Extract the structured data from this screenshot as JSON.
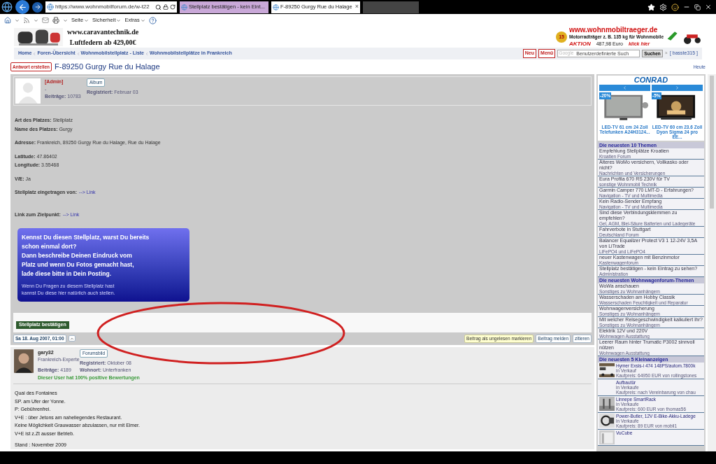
{
  "browser": {
    "address": "https://www.wohnmobilforum.de/w-t22",
    "tabs": [
      {
        "title": "Stellplatz bestätigen - kein Eint...",
        "selected": false
      },
      {
        "title": "F-89250 Gurgy Rue du Halage",
        "selected": true
      }
    ],
    "close": "×",
    "menus": [
      "Seite",
      "Sicherheit",
      "Extras"
    ]
  },
  "banner_left": {
    "line1": "www.caravantechnik.de",
    "line2": "Luftfedern ab 429,00€"
  },
  "banner_right": {
    "url": "www.wohnmobiltraeger.de",
    "text": "Motorradträger z. B. 135 kg für Wohnmobile",
    "badge": "AKTION",
    "price": "487,98 Euro",
    "link": "klick hier",
    "seal": "15"
  },
  "breadcrumb": [
    "Home",
    "Foren-Übersicht",
    "Wohnmobilstellplatz - Liste",
    "Wohnmobilstellplätze in Frankreich"
  ],
  "header_buttons": [
    "Neu",
    "Menü"
  ],
  "search": {
    "brand": "Google",
    "placeholder": "Benutzerdefinierte Such",
    "button": "Suchen",
    "clear": "×"
  },
  "user": "[ basste315 ]",
  "reply_button": "Antwort erstellen",
  "title": "F-89250 Gurgy Rue du Halage",
  "today": "Heute",
  "posts": [
    {
      "username": "[Admin]",
      "rank": "-",
      "badge": "Album",
      "photo": false,
      "stats": [
        {
          "label": "Beiträge:",
          "value": "10783"
        }
      ],
      "info": [
        {
          "label": "Registriert:",
          "value": "Februar 03"
        }
      ],
      "paragraphs": [
        [
          "**Art des Platzes:** Stellplatz",
          "**Name des Platzes:** Gurgy"
        ],
        [
          "**Adresse:** Frankreich, 89250 Gurgy Rue du Halage, Rue du Halage"
        ],
        [
          "**Latitude:** 47.86402",
          "**Longitude:** 3.55468"
        ],
        [
          "**V/E:** Ja"
        ]
      ],
      "links": [
        {
          "label": "Stellplatz eingetragen von:",
          "link": "--> Link"
        },
        {
          "label": "Link zum Zielpunkt:",
          "link": "--> Link"
        }
      ],
      "notice": {
        "lines": [
          "Kennst Du diesen Stellplatz, warst Du bereits",
          "schon einmal dort?",
          "Dann beschreibe Deinen Eindruck vom",
          "Platz und wenn Du Fotos gemacht hast,",
          "lade diese bitte in Dein Posting."
        ],
        "small": [
          "Wenn Du Fragen zu diesem Stellplatz hast",
          "kannst Du diese hier natürlich auch stellen."
        ]
      },
      "confirm_button": "Stellplatz bestätigen",
      "date": "Sa 18. Aug 2007, 01:00",
      "actions": [
        "Beitrag als ungelesen markieren",
        "Beitrag melden",
        "zitieren"
      ]
    },
    {
      "username": "gary32",
      "rank": "Frankreich-Experte",
      "badge": "Forumsbild",
      "photo": true,
      "stats": [
        {
          "label": "Beiträge:",
          "value": "4189"
        }
      ],
      "info": [
        {
          "label": "Registriert:",
          "value": "Oktober 08"
        },
        {
          "label": "Wohnort:",
          "value": "Unterfranken"
        }
      ],
      "rating": "Dieser User hat 100% positive Bewertungen",
      "paragraphs": [
        [
          "Quai des Fontaines",
          "SP. am Ufer der Yonne.",
          "P: Gebührenfrei.",
          "V+E : über Jetons am naheliegendes Restaurant.",
          "Keine Möglichkeit Grauwasser abzulassen, nur mit Eimer.",
          "V+E ist z.Zt ausser Betrieb."
        ],
        [
          "Stand : November 2009"
        ]
      ]
    }
  ],
  "ad": {
    "logo": "CONRAD",
    "products": [
      {
        "discount": "-20%",
        "name": "LED-TV 61 cm 24 Zoll Telefunken A24H3124..."
      },
      {
        "discount": "-5%",
        "name": "LED-TV 60 cm 23.6 Zoll Dyon Sigma 24 pro EE..."
      }
    ]
  },
  "sidebar": [
    {
      "title": "Die neuesten 10 Themen",
      "kind": "topics",
      "items": [
        {
          "title": "Empfehlung Stellplätze Kroatien",
          "forum": "Kroatien Forum"
        },
        {
          "title": "Älteres WoMo versichern, Vollkasko oder nicht?",
          "forum": "Nachrichten und Versicherungen"
        },
        {
          "title": "Eura Profila 670 RS 230V für TV",
          "forum": "sonstige Wohnmobil Technik"
        },
        {
          "title": "Garmin Camper 770 LMT-D - Erfahrungen?",
          "forum": "Navigation - TV und Multimedia"
        },
        {
          "title": "Kein Radio-Sender Empfang",
          "forum": "Navigation - TV und Multimedia"
        },
        {
          "title": "Sind diese Verbindungsklemmen zu empfehlen?",
          "forum": "Gel, AGM, Blei-Säure Batterien und Ladegeräte"
        },
        {
          "title": "Fahrverbote in Stuttgart",
          "forum": "Deutschland Forum"
        },
        {
          "title": "Balancer Equalizer Protect V3 1 12-24V 3,5A von LiTrade",
          "forum": "LiFePO4 und LiFePO4"
        },
        {
          "title": "neuer Kastenwagen mit Benzinmotor",
          "forum": "Kastenwagenforum"
        },
        {
          "title": "Stellplatz bestätigen - kein Eintrag zu sehen?",
          "forum": "Administration"
        }
      ]
    },
    {
      "title": "Die neuesten Wohnwagenforum-Themen",
      "kind": "topics",
      "items": [
        {
          "title": "WoWa anschauen",
          "forum": "Sonstiges zu Wohnanhängern"
        },
        {
          "title": "Wasserschaden am Hobby Classik",
          "forum": "Wasserschaden Feuchtigkeit und Reparatur"
        },
        {
          "title": "Wohnwagenversicherung",
          "forum": "Sonstiges zu Wohnanhängern"
        },
        {
          "title": "Mit welcher Reisegeschwindigkeit kalkuliert ihr?",
          "forum": "Sonstiges zu Wohnanhängern"
        },
        {
          "title": "Elektrik 12V und 220V",
          "forum": "Wohnwagen Ausstattung"
        },
        {
          "title": "Leerer Raum hinter Trumatic P3002 sinnvoll nützen",
          "forum": "Wohnwagen Ausstattung"
        }
      ]
    },
    {
      "title": "Die neuesten 5 Kleinanzeigen",
      "kind": "classifieds",
      "items": [
        {
          "title": "Hymer Exsis-i 474 148PS/autom.7800k",
          "category": "in Verkauf",
          "price": "Kaufpreis: 64950 EUR von rollingstones",
          "photo": true
        },
        {
          "title": "Aufbautür",
          "category": "in Verkaufe",
          "price": "Kaufpreis: nach Vereinbarung von chau",
          "photo": false
        },
        {
          "title": "Linnepe SmartRack",
          "category": "in Verkaufe",
          "price": "Kaufpreis: 600 EUR von thomas56",
          "photo": true
        },
        {
          "title": "Power-Butler, 12V E-Bike-Akku-Ladege",
          "category": "in Verkaufe",
          "price": "Kaufpreis: 89 EUR von mobil1",
          "photo": true
        },
        {
          "title": "VuCube",
          "photo": true
        }
      ]
    }
  ]
}
